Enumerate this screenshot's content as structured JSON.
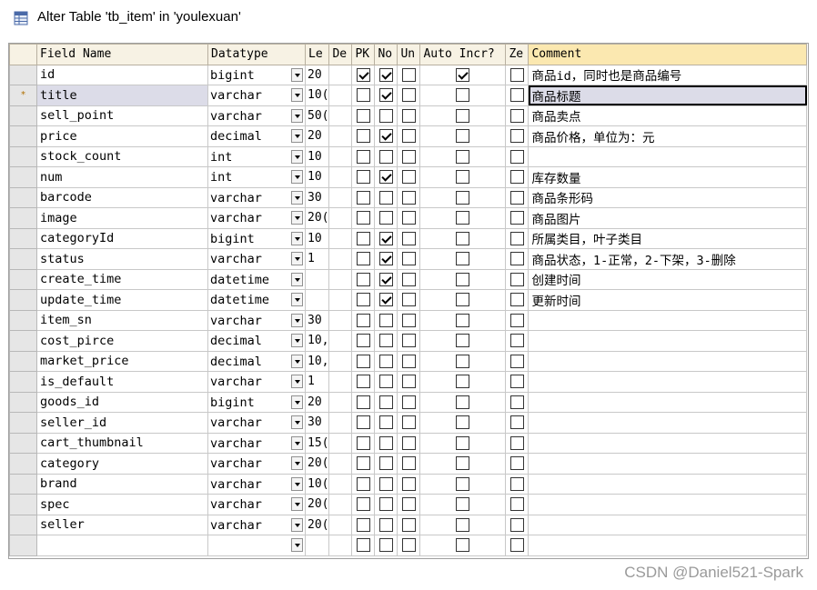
{
  "window": {
    "title": "Alter Table 'tb_item' in 'youlexuan'",
    "icon": "table-icon"
  },
  "columns": [
    "Field Name",
    "Datatype",
    "Le",
    "De",
    "PK",
    "No",
    "Un",
    "Auto Incr?",
    "Ze",
    "Comment"
  ],
  "rows": [
    {
      "field": "id",
      "datatype": "bigint",
      "len": "20",
      "pk": true,
      "notnull": true,
      "un": false,
      "ai": true,
      "ze": false,
      "comment": "商品id，同时也是商品编号"
    },
    {
      "field": "title",
      "datatype": "varchar",
      "len": "10(",
      "pk": false,
      "notnull": true,
      "un": false,
      "ai": false,
      "ze": false,
      "comment": "商品标题",
      "active": true,
      "marker": "*"
    },
    {
      "field": "sell_point",
      "datatype": "varchar",
      "len": "50(",
      "pk": false,
      "notnull": false,
      "un": false,
      "ai": false,
      "ze": false,
      "comment": "商品卖点"
    },
    {
      "field": "price",
      "datatype": "decimal",
      "len": "20",
      "pk": false,
      "notnull": true,
      "un": false,
      "ai": false,
      "ze": false,
      "comment": "商品价格，单位为：元"
    },
    {
      "field": "stock_count",
      "datatype": "int",
      "len": "10",
      "pk": false,
      "notnull": false,
      "un": false,
      "ai": false,
      "ze": false,
      "comment": ""
    },
    {
      "field": "num",
      "datatype": "int",
      "len": "10",
      "pk": false,
      "notnull": true,
      "un": false,
      "ai": false,
      "ze": false,
      "comment": "库存数量"
    },
    {
      "field": "barcode",
      "datatype": "varchar",
      "len": "30",
      "pk": false,
      "notnull": false,
      "un": false,
      "ai": false,
      "ze": false,
      "comment": "商品条形码"
    },
    {
      "field": "image",
      "datatype": "varchar",
      "len": "20(",
      "pk": false,
      "notnull": false,
      "un": false,
      "ai": false,
      "ze": false,
      "comment": "商品图片"
    },
    {
      "field": "categoryId",
      "datatype": "bigint",
      "len": "10",
      "pk": false,
      "notnull": true,
      "un": false,
      "ai": false,
      "ze": false,
      "comment": "所属类目，叶子类目"
    },
    {
      "field": "status",
      "datatype": "varchar",
      "len": "1",
      "pk": false,
      "notnull": true,
      "un": false,
      "ai": false,
      "ze": false,
      "comment": "商品状态，1-正常，2-下架，3-删除"
    },
    {
      "field": "create_time",
      "datatype": "datetime",
      "len": "",
      "pk": false,
      "notnull": true,
      "un": false,
      "ai": false,
      "ze": false,
      "comment": "创建时间"
    },
    {
      "field": "update_time",
      "datatype": "datetime",
      "len": "",
      "pk": false,
      "notnull": true,
      "un": false,
      "ai": false,
      "ze": false,
      "comment": "更新时间"
    },
    {
      "field": "item_sn",
      "datatype": "varchar",
      "len": "30",
      "pk": false,
      "notnull": false,
      "un": false,
      "ai": false,
      "ze": false,
      "comment": ""
    },
    {
      "field": "cost_pirce",
      "datatype": "decimal",
      "len": "10,",
      "pk": false,
      "notnull": false,
      "un": false,
      "ai": false,
      "ze": false,
      "comment": ""
    },
    {
      "field": "market_price",
      "datatype": "decimal",
      "len": "10,",
      "pk": false,
      "notnull": false,
      "un": false,
      "ai": false,
      "ze": false,
      "comment": ""
    },
    {
      "field": "is_default",
      "datatype": "varchar",
      "len": "1",
      "pk": false,
      "notnull": false,
      "un": false,
      "ai": false,
      "ze": false,
      "comment": ""
    },
    {
      "field": "goods_id",
      "datatype": "bigint",
      "len": "20",
      "pk": false,
      "notnull": false,
      "un": false,
      "ai": false,
      "ze": false,
      "comment": ""
    },
    {
      "field": "seller_id",
      "datatype": "varchar",
      "len": "30",
      "pk": false,
      "notnull": false,
      "un": false,
      "ai": false,
      "ze": false,
      "comment": ""
    },
    {
      "field": "cart_thumbnail",
      "datatype": "varchar",
      "len": "15(",
      "pk": false,
      "notnull": false,
      "un": false,
      "ai": false,
      "ze": false,
      "comment": ""
    },
    {
      "field": "category",
      "datatype": "varchar",
      "len": "20(",
      "pk": false,
      "notnull": false,
      "un": false,
      "ai": false,
      "ze": false,
      "comment": ""
    },
    {
      "field": "brand",
      "datatype": "varchar",
      "len": "10(",
      "pk": false,
      "notnull": false,
      "un": false,
      "ai": false,
      "ze": false,
      "comment": ""
    },
    {
      "field": "spec",
      "datatype": "varchar",
      "len": "20(",
      "pk": false,
      "notnull": false,
      "un": false,
      "ai": false,
      "ze": false,
      "comment": ""
    },
    {
      "field": "seller",
      "datatype": "varchar",
      "len": "20(",
      "pk": false,
      "notnull": false,
      "un": false,
      "ai": false,
      "ze": false,
      "comment": ""
    },
    {
      "field": "",
      "datatype": "",
      "len": "",
      "pk": false,
      "notnull": false,
      "un": false,
      "ai": false,
      "ze": false,
      "comment": ""
    }
  ],
  "watermark": "CSDN @Daniel521-Spark"
}
